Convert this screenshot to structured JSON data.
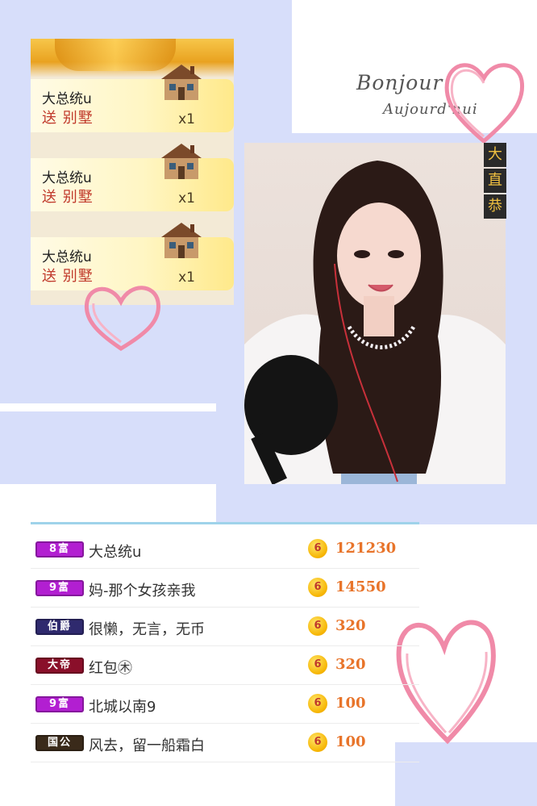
{
  "gift_panel": {
    "gifts": [
      {
        "sender": "大总统u",
        "action": "送 别墅",
        "quantity": "x1",
        "icon": "villa-icon"
      },
      {
        "sender": "大总统u",
        "action": "送 别墅",
        "quantity": "x1",
        "icon": "villa-icon"
      },
      {
        "sender": "大总统u",
        "action": "送 别墅",
        "quantity": "x1",
        "icon": "villa-icon"
      }
    ]
  },
  "decor": {
    "bonjour": "Bonjour",
    "aujourdhui": "Aujourd'hui"
  },
  "stream": {
    "side_tags": [
      "大",
      "直",
      "恭"
    ]
  },
  "ranking": {
    "coin_label": "6",
    "rows": [
      {
        "badge": "8富",
        "badge_color": "#b21fd1",
        "name": "大总统u",
        "amount": "121230"
      },
      {
        "badge": "9富",
        "badge_color": "#b21fd1",
        "name": "妈-那个女孩亲我",
        "amount": "14550"
      },
      {
        "badge": "伯爵",
        "badge_color": "#2f2a6e",
        "name": "很懒，无言，无币",
        "amount": "320"
      },
      {
        "badge": "大帝",
        "badge_color": "#8a0f2a",
        "name": "红包㊍",
        "amount": "320"
      },
      {
        "badge": "9富",
        "badge_color": "#b21fd1",
        "name": "北城以南9",
        "amount": "100"
      },
      {
        "badge": "国公",
        "badge_color": "#3a2a1a",
        "name": "风去，留一船霜白",
        "amount": "100"
      }
    ]
  },
  "colors": {
    "background_accent": "#d7defa",
    "heart_pink": "#f08aa8",
    "amount_orange": "#e8742a",
    "divider_blue": "#9fd3ea"
  }
}
